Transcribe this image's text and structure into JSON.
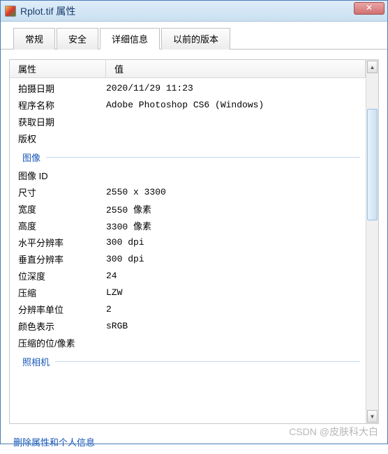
{
  "window": {
    "title": "Rplot.tif 属性",
    "close_glyph": "✕"
  },
  "tabs": {
    "items": [
      {
        "label": "常规"
      },
      {
        "label": "安全"
      },
      {
        "label": "详细信息"
      },
      {
        "label": "以前的版本"
      }
    ],
    "active_index": 2
  },
  "headers": {
    "name": "属性",
    "value": "值"
  },
  "rows_top": [
    {
      "name": "拍摄日期",
      "value": "2020/11/29 11:23"
    },
    {
      "name": "程序名称",
      "value": "Adobe Photoshop CS6 (Windows)"
    },
    {
      "name": "获取日期",
      "value": ""
    },
    {
      "name": "版权",
      "value": ""
    }
  ],
  "section_image": "图像",
  "rows_image": [
    {
      "name": "图像 ID",
      "value": ""
    },
    {
      "name": "尺寸",
      "value": "2550 x 3300"
    },
    {
      "name": "宽度",
      "value": "2550 像素"
    },
    {
      "name": "高度",
      "value": "3300 像素"
    },
    {
      "name": "水平分辨率",
      "value": "300 dpi"
    },
    {
      "name": "垂直分辨率",
      "value": "300 dpi"
    },
    {
      "name": "位深度",
      "value": "24"
    },
    {
      "name": "压缩",
      "value": "LZW"
    },
    {
      "name": "分辨率单位",
      "value": "2"
    },
    {
      "name": "颜色表示",
      "value": "sRGB"
    },
    {
      "name": "压缩的位/像素",
      "value": ""
    }
  ],
  "section_camera": "照相机",
  "link_text": "删除属性和个人信息",
  "watermark": "CSDN @皮肤科大白"
}
